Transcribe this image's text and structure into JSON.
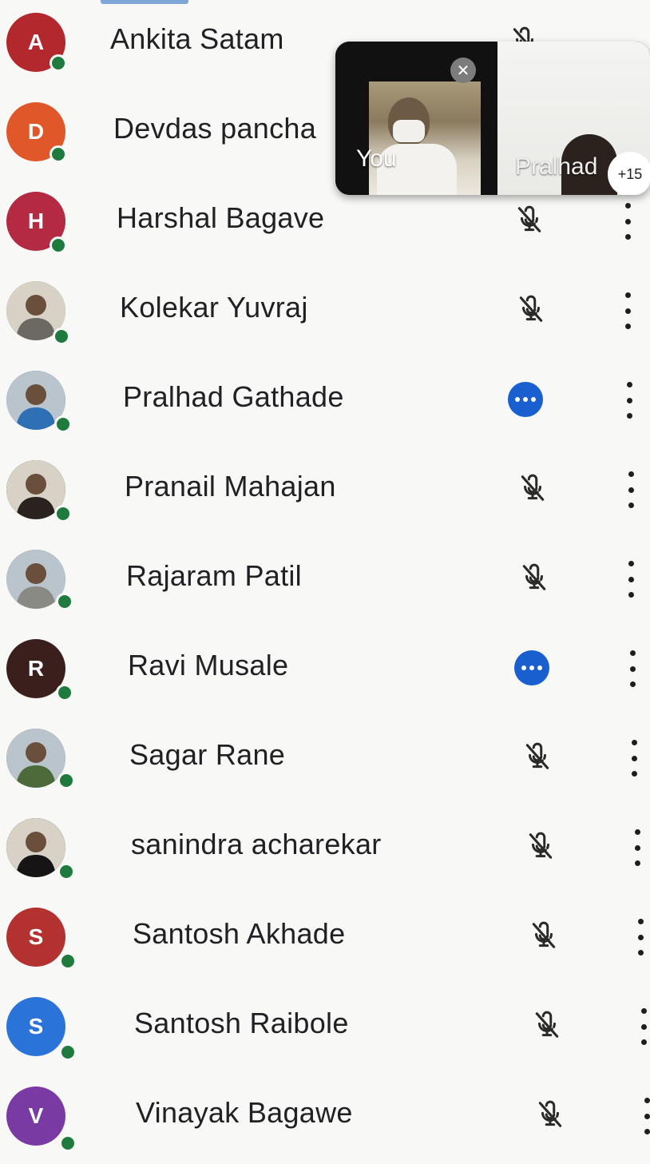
{
  "participants": [
    {
      "name": "Ankita Satam",
      "initial": "A",
      "avatar_color": "#b3282d",
      "avatar_type": "initial",
      "status": "muted"
    },
    {
      "name": "Devdas pancha",
      "initial": "D",
      "avatar_color": "#e0582a",
      "avatar_type": "initial",
      "status": "muted"
    },
    {
      "name": "Harshal Bagave",
      "initial": "H",
      "avatar_color": "#b32a42",
      "avatar_type": "initial",
      "status": "muted"
    },
    {
      "name": "Kolekar Yuvraj",
      "initial": "",
      "avatar_color": "#6c6862",
      "avatar_type": "photo",
      "status": "muted"
    },
    {
      "name": "Pralhad Gathade",
      "initial": "",
      "avatar_color": "#2f6fb3",
      "avatar_type": "photo",
      "status": "speaking"
    },
    {
      "name": "Pranail Mahajan",
      "initial": "",
      "avatar_color": "#2a221f",
      "avatar_type": "photo",
      "status": "muted"
    },
    {
      "name": "Rajaram Patil",
      "initial": "",
      "avatar_color": "#8a8a84",
      "avatar_type": "photo",
      "status": "muted"
    },
    {
      "name": "Ravi Musale",
      "initial": "R",
      "avatar_color": "#3a1f1c",
      "avatar_type": "initial",
      "status": "speaking"
    },
    {
      "name": "Sagar Rane",
      "initial": "",
      "avatar_color": "#4d6b3a",
      "avatar_type": "photo",
      "status": "muted"
    },
    {
      "name": "sanindra acharekar",
      "initial": "",
      "avatar_color": "#161414",
      "avatar_type": "photo",
      "status": "muted"
    },
    {
      "name": "Santosh Akhade",
      "initial": "S",
      "avatar_color": "#b3312e",
      "avatar_type": "initial",
      "status": "muted"
    },
    {
      "name": "Santosh Raibole",
      "initial": "S",
      "avatar_color": "#2a73d8",
      "avatar_type": "initial",
      "status": "muted"
    },
    {
      "name": "Vinayak Bagawe",
      "initial": "V",
      "avatar_color": "#7a3aa3",
      "avatar_type": "initial",
      "status": "muted"
    }
  ],
  "video_tiles": {
    "self_label": "You",
    "other_label": "Pralhad",
    "more_count": "+15",
    "close_icon": "close-icon"
  },
  "icons": {
    "mic_off": "mic-off-icon",
    "speaking": "speaking-indicator-icon",
    "more": "more-vert-icon"
  },
  "colors": {
    "online": "#1f7a3d",
    "speaking": "#1a5fd0",
    "accent_bar": "#7fa6d8"
  }
}
